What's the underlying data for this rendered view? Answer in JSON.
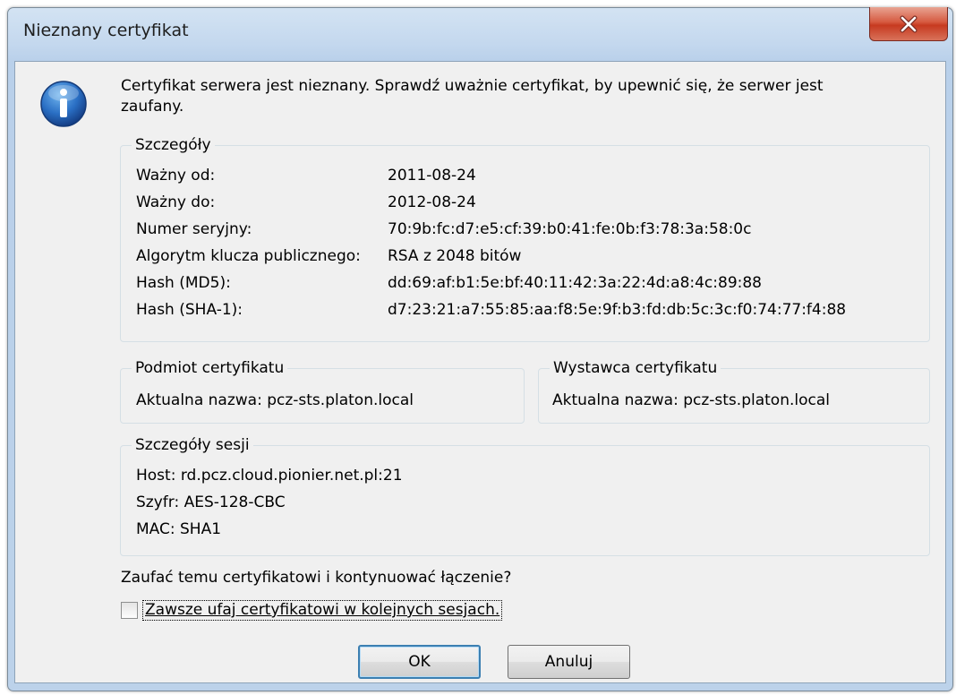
{
  "window": {
    "title": "Nieznany certyfikat"
  },
  "message": "Certyfikat serwera jest nieznany. Sprawdź uważnie certyfikat, by upewnić się, że serwer jest zaufany.",
  "details": {
    "legend": "Szczegóły",
    "rows": [
      {
        "label": "Ważny od:",
        "value": "2011-08-24"
      },
      {
        "label": "Ważny do:",
        "value": "2012-08-24"
      },
      {
        "label": "Numer seryjny:",
        "value": "70:9b:fc:d7:e5:cf:39:b0:41:fe:0b:f3:78:3a:58:0c"
      },
      {
        "label": "Algorytm klucza publicznego:",
        "value": "RSA z 2048 bitów"
      },
      {
        "label": "Hash (MD5):",
        "value": "dd:69:af:b1:5e:bf:40:11:42:3a:22:4d:a8:4c:89:88"
      },
      {
        "label": "Hash (SHA-1):",
        "value": "d7:23:21:a7:55:85:aa:f8:5e:9f:b3:fd:db:5c:3c:f0:74:77:f4:88"
      }
    ]
  },
  "subject": {
    "legend": "Podmiot certyfikatu",
    "text": "Aktualna nazwa: pcz-sts.platon.local"
  },
  "issuer": {
    "legend": "Wystawca certyfikatu",
    "text": "Aktualna nazwa: pcz-sts.platon.local"
  },
  "session": {
    "legend": "Szczegóły sesji",
    "rows": [
      {
        "label": "Host:",
        "value": "rd.pcz.cloud.pionier.net.pl:21"
      },
      {
        "label": "Szyfr:",
        "value": "AES-128-CBC"
      },
      {
        "label": "MAC:",
        "value": "SHA1"
      }
    ]
  },
  "question": "Zaufać temu certyfikatowi i kontynuować łączenie?",
  "always_trust": {
    "label": "Zawsze ufaj certyfikatowi w kolejnych sesjach.",
    "checked": false
  },
  "buttons": {
    "ok": "OK",
    "cancel": "Anuluj"
  },
  "icons": {
    "info": "info-icon",
    "close": "close-icon"
  }
}
